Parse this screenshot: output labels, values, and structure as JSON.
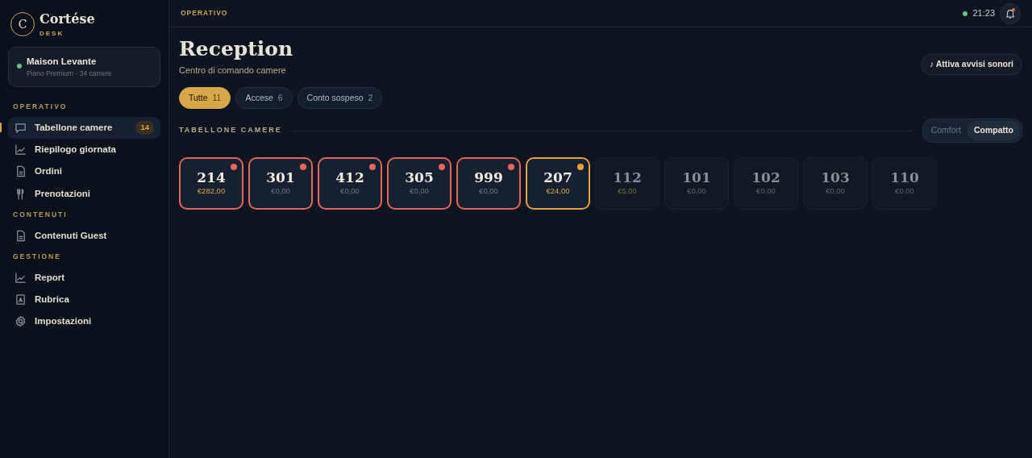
{
  "brand": {
    "name": "Cortése",
    "sub": "DESK",
    "logo_letter": "C"
  },
  "property": {
    "name": "Maison Levante",
    "detail": "Piano Premium · 34 camere",
    "online": true
  },
  "sidebar": {
    "sections": [
      {
        "title": "OPERATIVO",
        "items": [
          {
            "label": "Tabellone camere",
            "kind": "chat",
            "selected": true,
            "badge": "14"
          },
          {
            "label": "Riepilogo giornata",
            "kind": "chart",
            "selected": false
          },
          {
            "label": "Ordini",
            "kind": "doc",
            "selected": false
          },
          {
            "label": "Prenotazioni",
            "kind": "cutlery",
            "selected": false
          }
        ]
      },
      {
        "title": "CONTENUTI",
        "items": [
          {
            "label": "Contenuti Guest",
            "kind": "doc",
            "selected": false
          }
        ]
      },
      {
        "title": "GESTIONE",
        "items": [
          {
            "label": "Report",
            "kind": "chart",
            "selected": false
          },
          {
            "label": "Rubrica",
            "kind": "contact",
            "selected": false
          },
          {
            "label": "Impostazioni",
            "kind": "gear",
            "selected": false
          }
        ]
      }
    ]
  },
  "topbar": {
    "breadcrumb": "OPERATIVO",
    "time": "21:23",
    "online": true,
    "notification_unread": true
  },
  "header": {
    "title": "Reception",
    "subtitle": "Centro di comando camere",
    "sound_button": "♪ Attiva avvisi sonori"
  },
  "filters": [
    {
      "label": "Tutte",
      "count": "11",
      "selected": true
    },
    {
      "label": "Accese",
      "count": "6",
      "selected": false
    },
    {
      "label": "Conto sospeso",
      "count": "2",
      "selected": false
    }
  ],
  "board": {
    "title": "TABELLONE CAMERE",
    "density": [
      {
        "label": "Comfort",
        "selected": false
      },
      {
        "label": "Compatto",
        "selected": true
      }
    ],
    "rooms": [
      {
        "number": "214",
        "amount": "€282,00",
        "active": true,
        "has_balance": true,
        "color": "#e0675a"
      },
      {
        "number": "301",
        "amount": "€0,00",
        "active": true,
        "has_balance": false,
        "color": "#e0675a"
      },
      {
        "number": "412",
        "amount": "€0,00",
        "active": true,
        "has_balance": false,
        "color": "#e0675a"
      },
      {
        "number": "305",
        "amount": "€0,00",
        "active": true,
        "has_balance": false,
        "color": "#e0675a"
      },
      {
        "number": "999",
        "amount": "€0,00",
        "active": true,
        "has_balance": false,
        "color": "#e0675a"
      },
      {
        "number": "207",
        "amount": "€24,00",
        "active": true,
        "has_balance": true,
        "color": "#e9a03c"
      },
      {
        "number": "112",
        "amount": "€5,00",
        "active": false,
        "has_balance": true
      },
      {
        "number": "101",
        "amount": "€0,00",
        "active": false,
        "has_balance": false
      },
      {
        "number": "102",
        "amount": "€0,00",
        "active": false,
        "has_balance": false
      },
      {
        "number": "103",
        "amount": "€0,00",
        "active": false,
        "has_balance": false
      },
      {
        "number": "110",
        "amount": "€0,00",
        "active": false,
        "has_balance": false
      }
    ]
  }
}
